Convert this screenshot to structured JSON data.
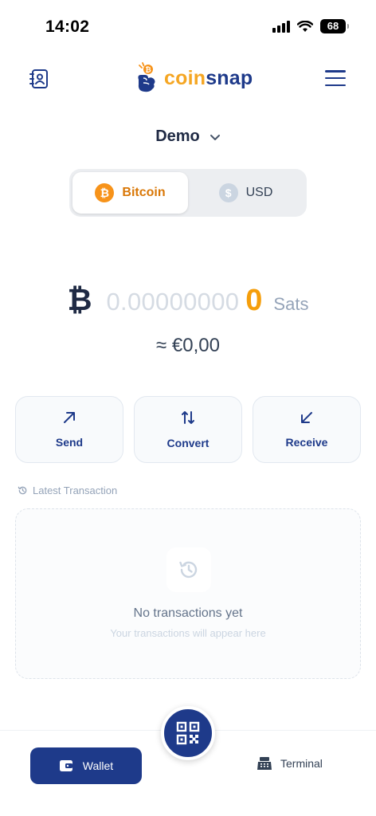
{
  "status_bar": {
    "time": "14:02",
    "battery": "68"
  },
  "header": {
    "logo_brand_first": "coin",
    "logo_brand_second": "snap"
  },
  "wallet": {
    "name": "Demo"
  },
  "currency_toggle": {
    "options": [
      {
        "label": "Bitcoin",
        "icon": "bitcoin-coin-icon",
        "active": true
      },
      {
        "label": "USD",
        "icon": "dollar-coin-icon",
        "active": false
      }
    ]
  },
  "balance": {
    "symbol": "₿",
    "zeros": "0.00000000",
    "value": "0",
    "unit": "Sats",
    "fiat": "≈ €0,00"
  },
  "actions": [
    {
      "label": "Send",
      "icon": "arrow-up-right-icon"
    },
    {
      "label": "Convert",
      "icon": "swap-arrows-icon"
    },
    {
      "label": "Receive",
      "icon": "arrow-down-left-icon"
    }
  ],
  "transactions": {
    "title": "Latest Transaction",
    "empty_title": "No transactions yet",
    "empty_subtitle": "Your transactions will appear here"
  },
  "bottom_nav": {
    "wallet_label": "Wallet",
    "terminal_label": "Terminal"
  },
  "colors": {
    "brand_navy": "#1e3a8a",
    "bitcoin_orange": "#f7931a",
    "balance_orange": "#f59e0b"
  }
}
